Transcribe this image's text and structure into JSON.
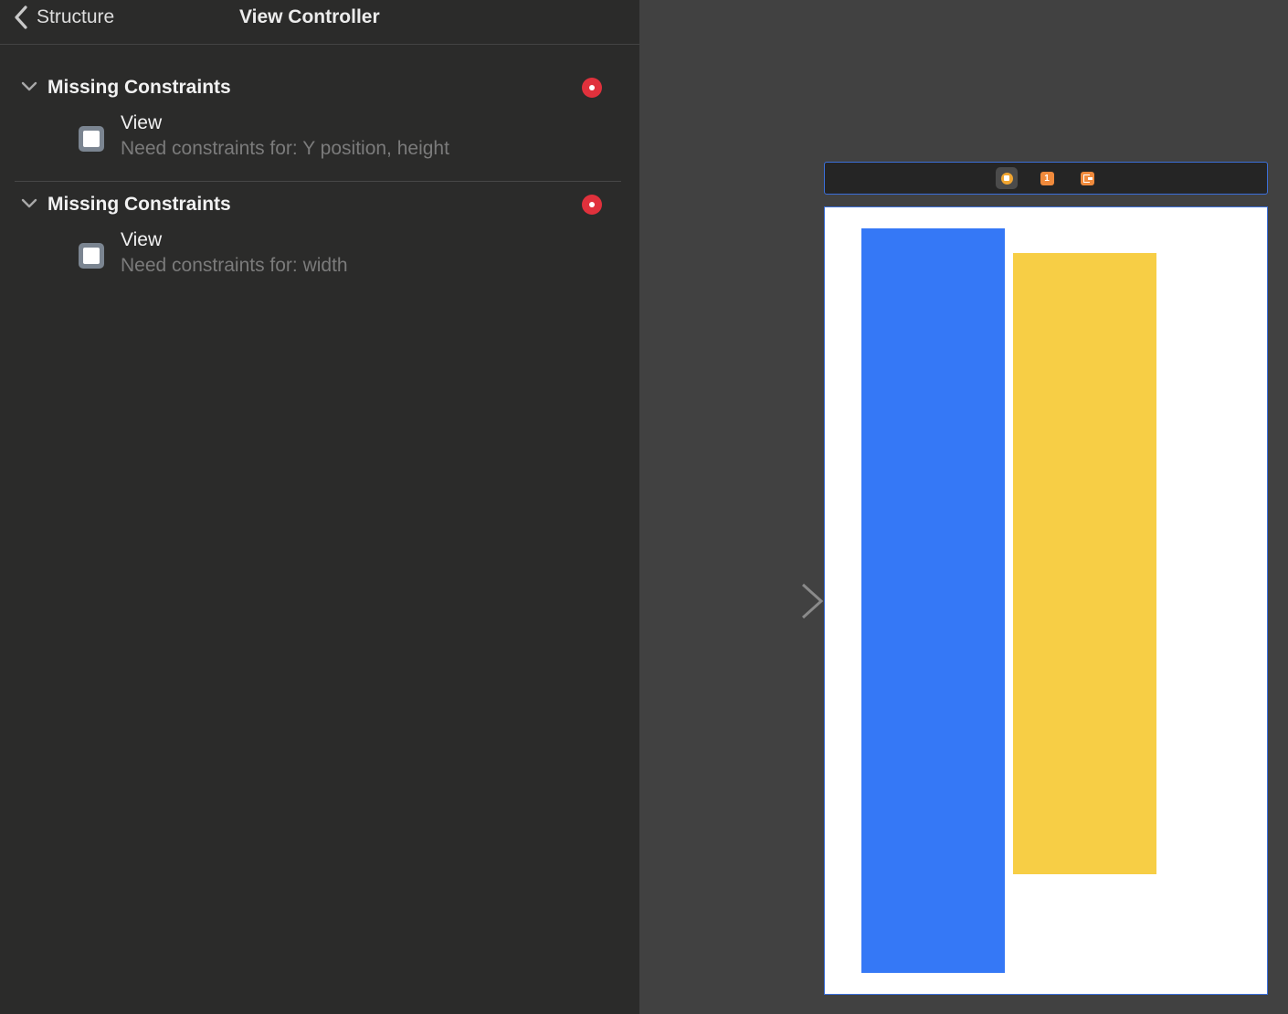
{
  "header": {
    "back_label": "Structure",
    "title": "View Controller"
  },
  "issue_groups": [
    {
      "title": "Missing Constraints",
      "items": [
        {
          "title": "View",
          "subtitle": "Need constraints for: Y position, height"
        }
      ]
    },
    {
      "title": "Missing Constraints",
      "items": [
        {
          "title": "View",
          "subtitle": "Need constraints for: width"
        }
      ]
    }
  ],
  "scene_dock": {
    "icons": [
      "view-controller-icon",
      "first-responder-icon",
      "exit-icon"
    ],
    "first_responder_glyph": "1"
  },
  "colors": {
    "panel_bg": "#2b2b2a",
    "canvas_bg": "#414141",
    "error_red": "#e0313c",
    "selection_blue": "#3b6fd9",
    "blue_view": "#3578f6",
    "yellow_view": "#f7ce45"
  }
}
